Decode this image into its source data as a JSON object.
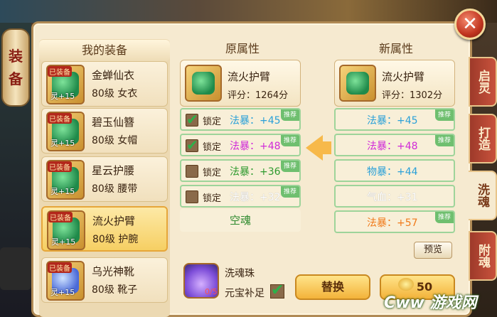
{
  "side_title": [
    "装",
    "备"
  ],
  "tabs": [
    "启灵",
    "打造",
    "洗魂",
    "附魂"
  ],
  "left": {
    "header": "我的装备",
    "items": [
      {
        "name": "金蝉仙衣",
        "level": "80级",
        "slot": "女衣",
        "tag": "已装备",
        "lv": "灵+15"
      },
      {
        "name": "碧玉仙簪",
        "level": "80级",
        "slot": "女帽",
        "tag": "已装备",
        "lv": "灵+15"
      },
      {
        "name": "星云护腰",
        "level": "80级",
        "slot": "腰带",
        "tag": "已装备",
        "lv": "灵+15"
      },
      {
        "name": "流火护臂",
        "level": "80级",
        "slot": "护腕",
        "tag": "已装备",
        "lv": "灵+15"
      },
      {
        "name": "乌光神靴",
        "level": "80级",
        "slot": "靴子",
        "tag": "已装备",
        "lv": "灵+15"
      }
    ]
  },
  "orig": {
    "header": "原属性",
    "name": "流火护臂",
    "score": "评分：1264分",
    "rows": [
      {
        "lock": "锁定",
        "attr": "法暴：+45",
        "color": "#2aa0d8",
        "checked": true,
        "rec": "推荐"
      },
      {
        "lock": "锁定",
        "attr": "法暴：+48",
        "color": "#d02ad8",
        "checked": true,
        "rec": "推荐"
      },
      {
        "lock": "锁定",
        "attr": "法暴：+36",
        "color": "#2e9a2e",
        "checked": false,
        "rec": "推荐"
      },
      {
        "lock": "锁定",
        "attr": "法暴：+32",
        "color": "#ffffff",
        "checked": false,
        "rec": "推荐"
      }
    ],
    "empty": "空魂"
  },
  "new": {
    "header": "新属性",
    "name": "流火护臂",
    "score": "评分：1302分",
    "rows": [
      {
        "attr": "法暴：+45",
        "color": "#2aa0d8",
        "rec": "推荐"
      },
      {
        "attr": "法暴：+48",
        "color": "#d02ad8",
        "rec": "推荐"
      },
      {
        "attr": "物暴：+44",
        "color": "#2aa0d8",
        "rec": ""
      },
      {
        "attr": "气血：+31",
        "color": "#ffffff",
        "rec": ""
      },
      {
        "attr": "法暴：+57",
        "color": "#f07a1a",
        "rec": "推荐"
      }
    ]
  },
  "preview_label": "预览",
  "gem": {
    "name": "洗魂珠",
    "count": "0/5",
    "auto": "元宝补足"
  },
  "replace_label": "替换",
  "cost": "50",
  "watermark": "Cww 游戏网"
}
